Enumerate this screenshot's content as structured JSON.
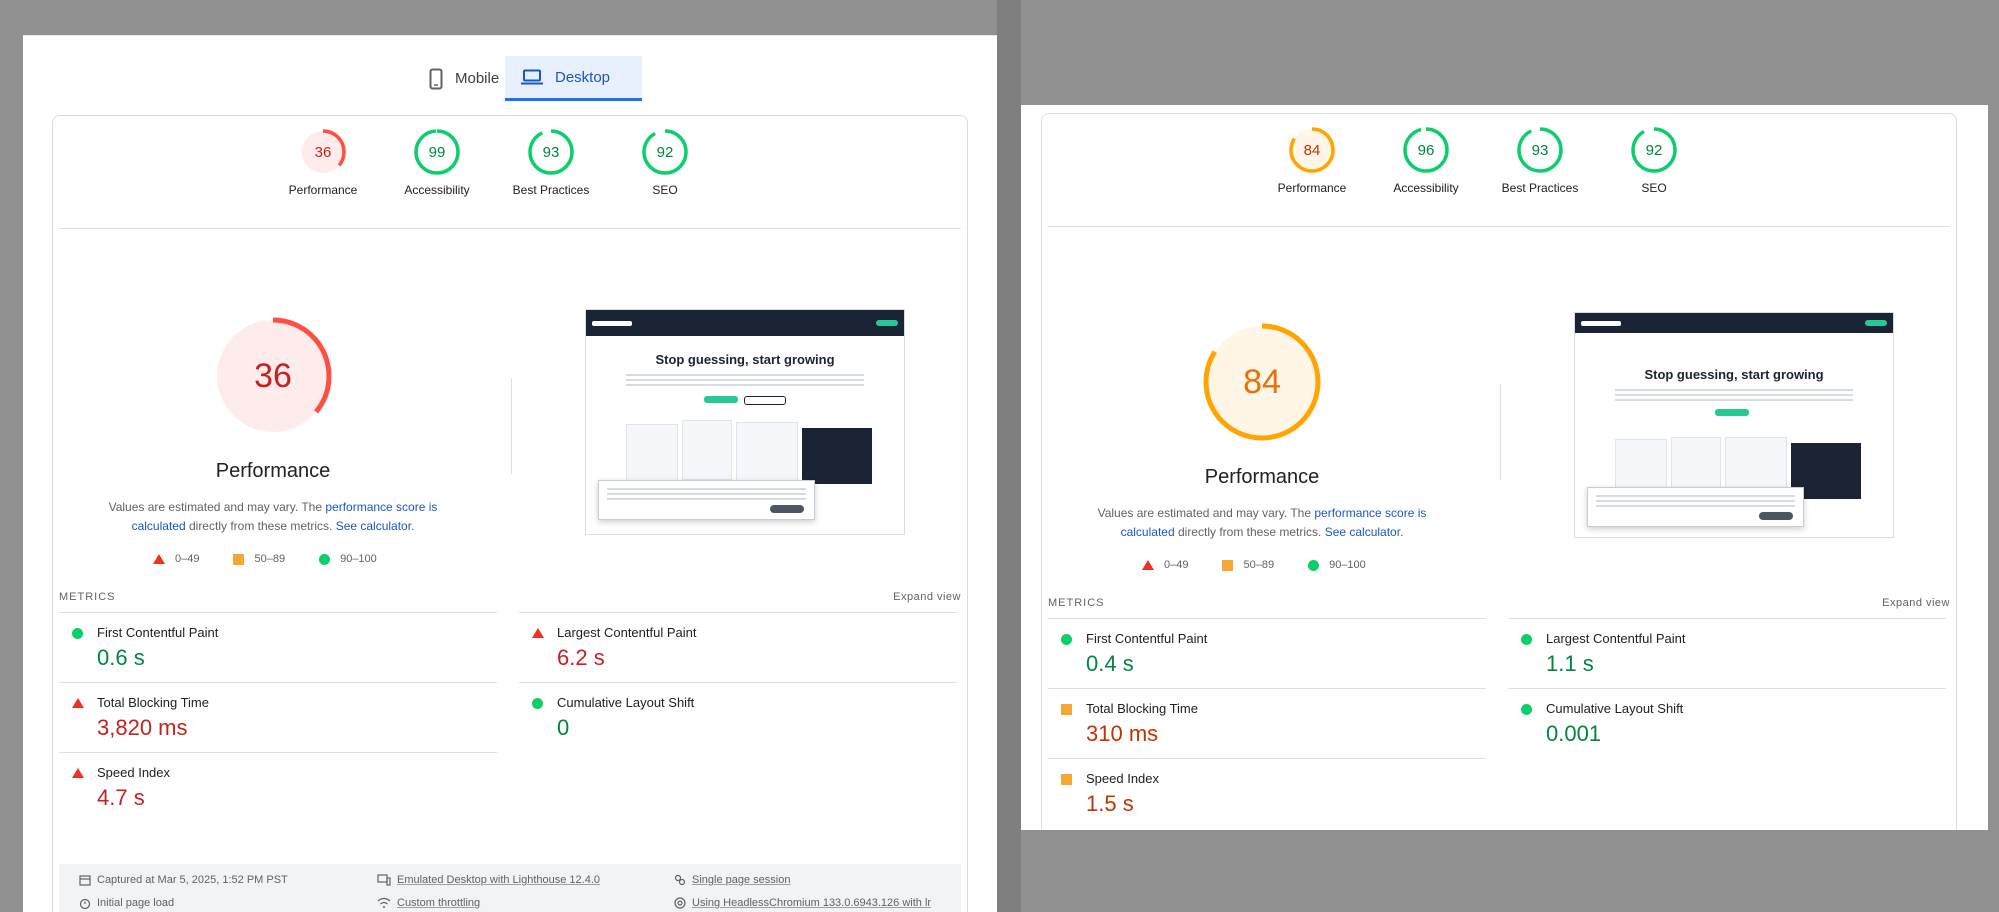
{
  "tabs": {
    "mobile": "Mobile",
    "desktop": "Desktop"
  },
  "colors": {
    "pass": "#0cce6b",
    "average": "#ffa400",
    "fail": "#ff4e42",
    "accent": "#1a73e8"
  },
  "legend": {
    "fail": "0–49",
    "average": "50–89",
    "pass": "90–100"
  },
  "metrics_label": "METRICS",
  "expand_label": "Expand view",
  "performance_title": "Performance",
  "note": {
    "prefix": "Values are estimated and may vary. The ",
    "link1": "performance score is calculated",
    "middle": " directly from these metrics. ",
    "link2": "See calculator."
  },
  "screenshot": {
    "headline": "Stop guessing, start growing"
  },
  "left": {
    "categories": [
      {
        "label": "Performance",
        "score": "36",
        "status": "fail"
      },
      {
        "label": "Accessibility",
        "score": "99",
        "status": "pass"
      },
      {
        "label": "Best Practices",
        "score": "93",
        "status": "pass"
      },
      {
        "label": "SEO",
        "score": "92",
        "status": "pass"
      }
    ],
    "performance_score": "36",
    "metrics": {
      "fcp": {
        "name": "First Contentful Paint",
        "value": "0.6 s",
        "status": "pass"
      },
      "lcp": {
        "name": "Largest Contentful Paint",
        "value": "6.2 s",
        "status": "fail"
      },
      "tbt": {
        "name": "Total Blocking Time",
        "value": "3,820 ms",
        "status": "fail"
      },
      "cls": {
        "name": "Cumulative Layout Shift",
        "value": "0",
        "status": "pass"
      },
      "si": {
        "name": "Speed Index",
        "value": "4.7 s",
        "status": "fail"
      }
    },
    "footer": {
      "captured": "Captured at Mar 5, 2025, 1:52 PM PST",
      "load": "Initial page load",
      "emulated": "Emulated Desktop with Lighthouse 12.4.0",
      "throttling": "Custom throttling",
      "session": "Single page session",
      "browser": "Using HeadlessChromium 133.0.6943.126 with lr"
    }
  },
  "right": {
    "categories": [
      {
        "label": "Performance",
        "score": "84",
        "status": "average"
      },
      {
        "label": "Accessibility",
        "score": "96",
        "status": "pass"
      },
      {
        "label": "Best Practices",
        "score": "93",
        "status": "pass"
      },
      {
        "label": "SEO",
        "score": "92",
        "status": "pass"
      }
    ],
    "performance_score": "84",
    "metrics": {
      "fcp": {
        "name": "First Contentful Paint",
        "value": "0.4 s",
        "status": "pass"
      },
      "lcp": {
        "name": "Largest Contentful Paint",
        "value": "1.1 s",
        "status": "pass"
      },
      "tbt": {
        "name": "Total Blocking Time",
        "value": "310 ms",
        "status": "average"
      },
      "cls": {
        "name": "Cumulative Layout Shift",
        "value": "0.001",
        "status": "pass"
      },
      "si": {
        "name": "Speed Index",
        "value": "1.5 s",
        "status": "average"
      }
    }
  }
}
